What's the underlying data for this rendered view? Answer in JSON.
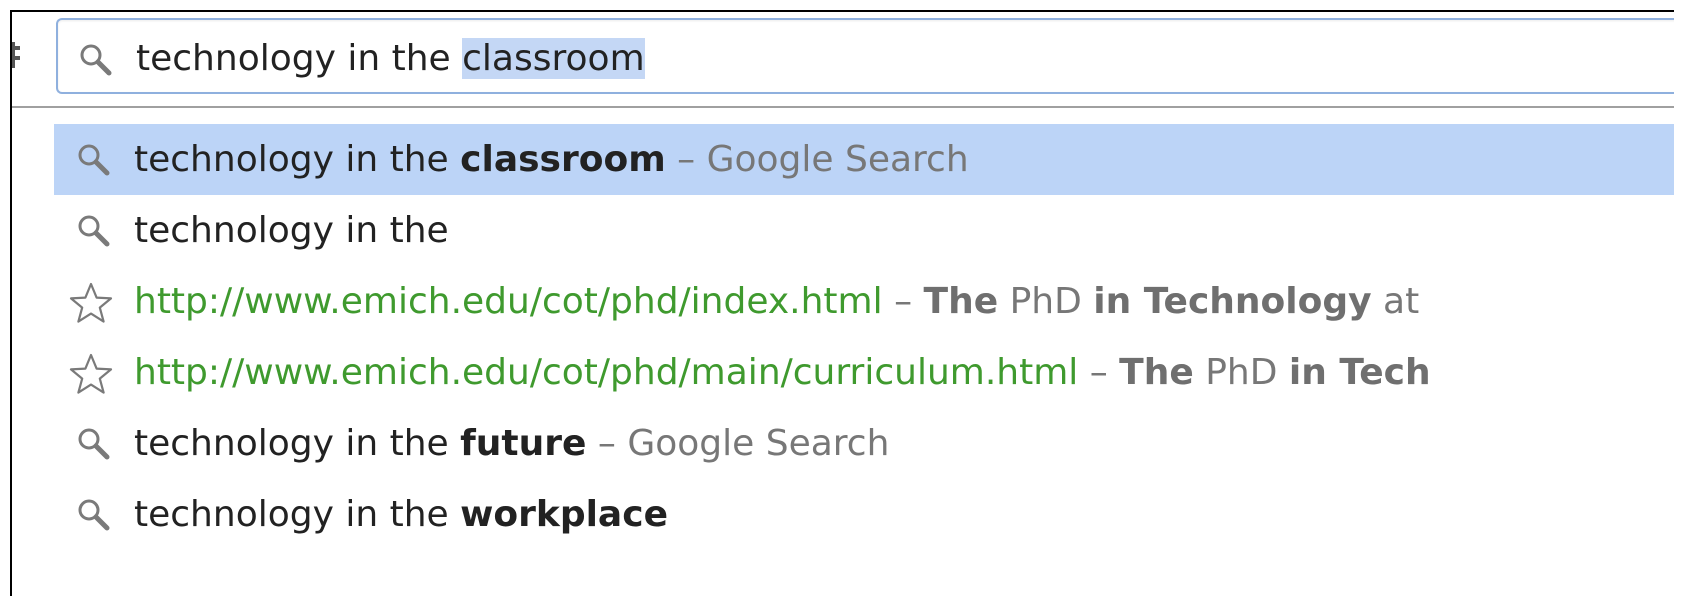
{
  "omnibox": {
    "typed": "technology in the ",
    "autocomplete": "classroom"
  },
  "suggestions": [
    {
      "type": "search",
      "selected": true,
      "prefix": "technology in the ",
      "bold": "classroom",
      "separator": " – ",
      "suffix": "Google Search"
    },
    {
      "type": "search",
      "selected": false,
      "prefix": "technology in the",
      "bold": "",
      "separator": "",
      "suffix": ""
    },
    {
      "type": "bookmark",
      "selected": false,
      "url": "http://www.emich.edu/cot/phd/index.html",
      "separator": " – ",
      "title_parts": [
        "The",
        " PhD ",
        "in Technology",
        " at"
      ]
    },
    {
      "type": "bookmark",
      "selected": false,
      "url": "http://www.emich.edu/cot/phd/main/curriculum.html",
      "separator": " – ",
      "title_parts": [
        "The",
        " PhD ",
        "in Tech"
      ]
    },
    {
      "type": "search",
      "selected": false,
      "prefix": "technology in the ",
      "bold": "future",
      "separator": " – ",
      "suffix": "Google Search"
    },
    {
      "type": "search",
      "selected": false,
      "prefix": "technology in the ",
      "bold": "workplace",
      "separator": "",
      "suffix": ""
    }
  ],
  "colors": {
    "selected_row": "#bcd4f7",
    "autocomplete_highlight": "#c4d7f5",
    "url_green": "#3f9a2e",
    "focus_border": "#8fb0de"
  },
  "icons": {
    "search": "search-icon",
    "bookmark": "star-icon"
  }
}
